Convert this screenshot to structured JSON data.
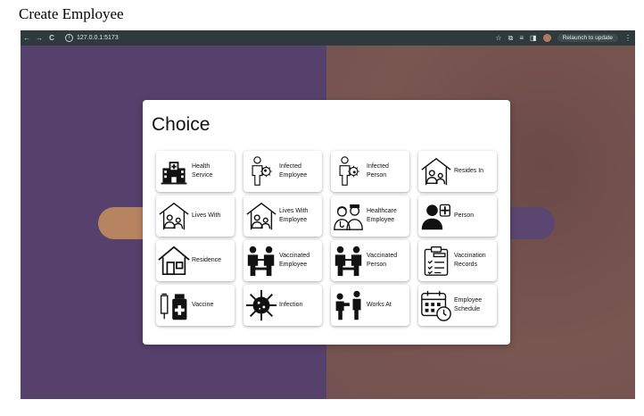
{
  "page": {
    "heading": "Create Employee"
  },
  "browser": {
    "url": "127.0.0.1:5173",
    "relaunch_label": "Relaunch to update",
    "back_glyph": "←",
    "forward_glyph": "→",
    "reload_glyph": "C",
    "icons": [
      "star-icon",
      "extension-icon",
      "reading-list-icon",
      "sidepanel-icon",
      "profile-avatar",
      "menu-icon"
    ]
  },
  "modal": {
    "title": "Choice",
    "choices": [
      {
        "label": "Health Service",
        "icon": "hospital-icon"
      },
      {
        "label": "Infected Employee",
        "icon": "infected-employee-icon"
      },
      {
        "label": "Infected Person",
        "icon": "infected-person-icon"
      },
      {
        "label": "Resides In",
        "icon": "resides-in-icon"
      },
      {
        "label": "Lives With",
        "icon": "lives-with-icon"
      },
      {
        "label": "Lives With Employee",
        "icon": "lives-with-employee-icon"
      },
      {
        "label": "Healthcare Employee",
        "icon": "healthcare-employee-icon"
      },
      {
        "label": "Person",
        "icon": "person-icon"
      },
      {
        "label": "Residence",
        "icon": "residence-icon"
      },
      {
        "label": "Vaccinated Employee",
        "icon": "vaccinated-employee-icon"
      },
      {
        "label": "Vaccinated Person",
        "icon": "vaccinated-person-icon"
      },
      {
        "label": "Vaccination Records",
        "icon": "vaccination-records-icon"
      },
      {
        "label": "Vaccine",
        "icon": "vaccine-icon"
      },
      {
        "label": "Infection",
        "icon": "virus-icon"
      },
      {
        "label": "Works At",
        "icon": "works-at-icon"
      },
      {
        "label": "Employee Schedule",
        "icon": "schedule-icon"
      }
    ]
  },
  "colors": {
    "left_bg": "#55416b",
    "right_bg": "#7a5651",
    "chrome": "#2f3a3c"
  }
}
